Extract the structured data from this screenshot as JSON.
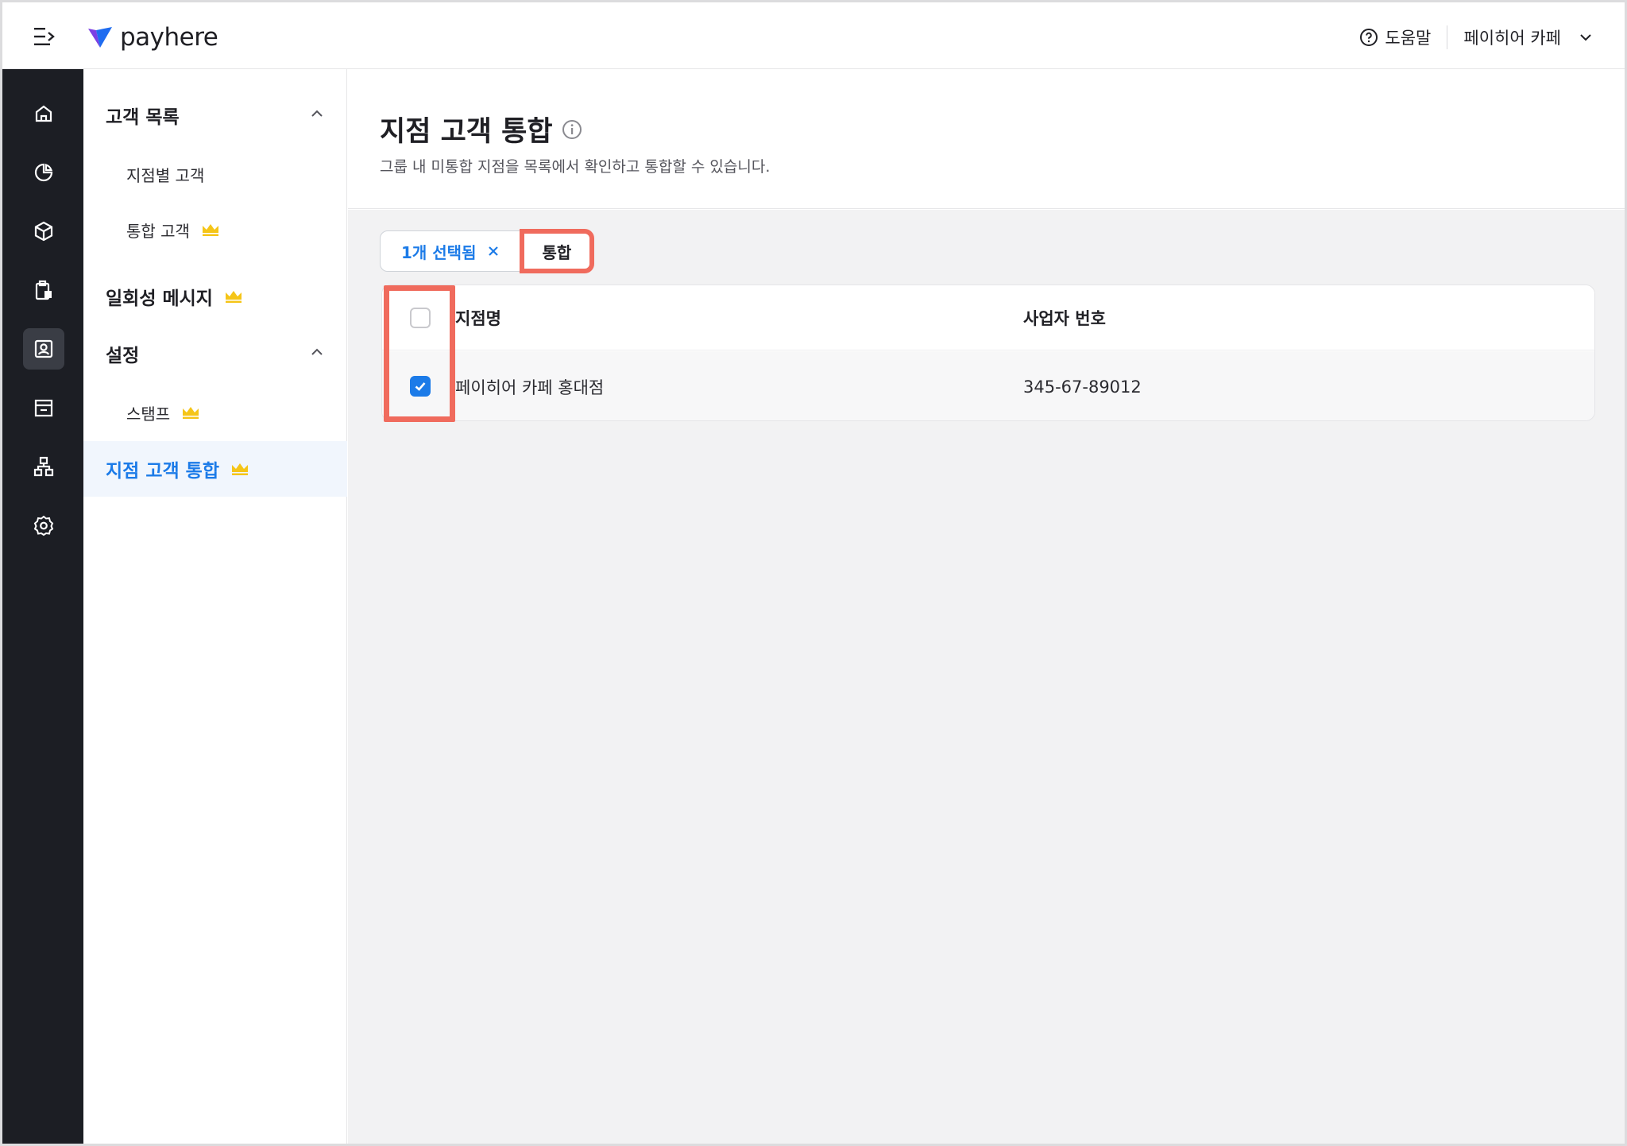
{
  "header": {
    "logo_text": "payhere",
    "help_label": "도움말",
    "store_name": "페이히어 카페"
  },
  "rail": {
    "icons": [
      "home-icon",
      "chart-pie-icon",
      "box-icon",
      "clipboard-icon",
      "customer-icon",
      "store-icon",
      "org-chart-icon",
      "settings-icon"
    ],
    "active": "customer-icon"
  },
  "sidebar": {
    "customer_list": "고객 목록",
    "by_branch": "지점별 고객",
    "integrated": "통합 고객",
    "one_time_message": "일회성 메시지",
    "settings": "설정",
    "stamp": "스탬프",
    "branch_merge": "지점 고객 통합"
  },
  "page": {
    "title": "지점 고객 통합",
    "description": "그룹 내 미통합 지점을 목록에서 확인하고 통합할 수 있습니다."
  },
  "toolbar": {
    "selected_label": "1개 선택됨",
    "merge_label": "통합"
  },
  "table": {
    "columns": [
      "지점명",
      "사업자 번호"
    ],
    "rows": [
      {
        "name": "페이히어 카페 홍대점",
        "biz_no": "345-67-89012",
        "checked": true
      }
    ]
  },
  "colors": {
    "accent": "#1c7be8",
    "crown": "#f5c518",
    "highlight": "#f06b5d",
    "rail": "#1c1e24"
  }
}
